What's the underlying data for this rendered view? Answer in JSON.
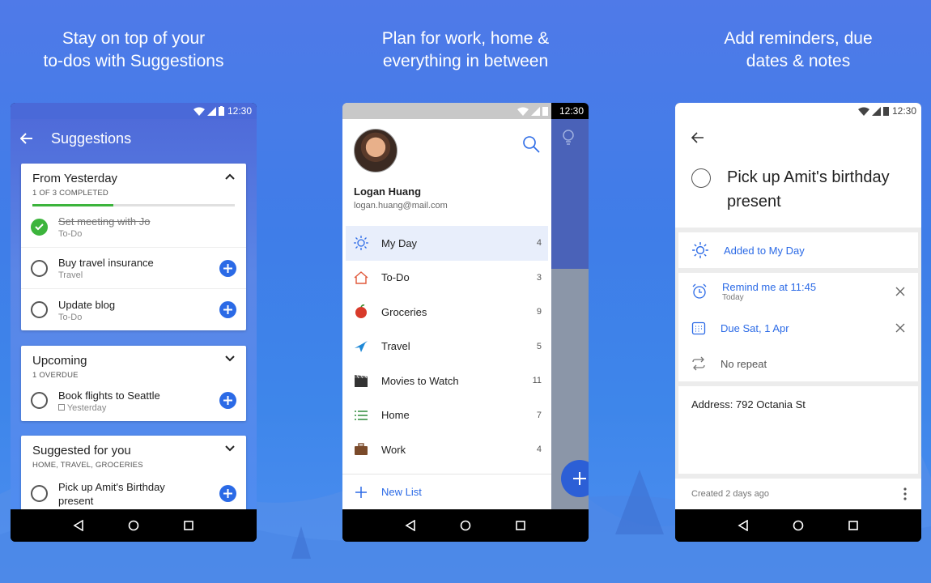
{
  "captions": [
    {
      "line1": "Stay on top of your",
      "line2": "to-dos with Suggestions"
    },
    {
      "line1": "Plan for work, home &",
      "line2": "everything in between"
    },
    {
      "line1": "Add reminders, due",
      "line2": "dates & notes"
    }
  ],
  "status_time": "12:30",
  "phone1": {
    "header_title": "Suggestions",
    "cards": [
      {
        "title": "From Yesterday",
        "subtitle": "1 OF 3 COMPLETED",
        "progress": 0.33,
        "tasks": [
          {
            "name": "Set meeting with Jo",
            "list": "To-Do",
            "completed": true
          },
          {
            "name": "Buy travel insurance",
            "list": "Travel",
            "completed": false
          },
          {
            "name": "Update blog",
            "list": "To-Do",
            "completed": false
          }
        ]
      },
      {
        "title": "Upcoming",
        "subtitle": "1 OVERDUE",
        "tasks": [
          {
            "name": "Book flights to Seattle",
            "list": "Yesterday",
            "completed": false
          }
        ]
      },
      {
        "title": "Suggested for you",
        "subtitle": "HOME, TRAVEL, GROCERIES",
        "tasks": [
          {
            "name": "Pick up Amit's Birthday present",
            "list": "",
            "completed": false
          }
        ]
      }
    ]
  },
  "phone2": {
    "user_name": "Logan Huang",
    "user_email": "logan.huang@mail.com",
    "lists": [
      {
        "label": "My Day",
        "count": "4",
        "icon": "sun-icon",
        "selected": true
      },
      {
        "label": "To-Do",
        "count": "3",
        "icon": "home-icon"
      },
      {
        "label": "Groceries",
        "count": "9",
        "icon": "apple-icon"
      },
      {
        "label": "Travel",
        "count": "5",
        "icon": "airplane-icon"
      },
      {
        "label": "Movies to Watch",
        "count": "11",
        "icon": "clapperboard-icon"
      },
      {
        "label": "Home",
        "count": "7",
        "icon": "list-icon"
      },
      {
        "label": "Work",
        "count": "4",
        "icon": "briefcase-icon"
      }
    ],
    "new_list_label": "New List"
  },
  "phone3": {
    "task_title_line1": "Pick up Amit's birthday",
    "task_title_line2": "present",
    "my_day_label": "Added to My Day",
    "reminder_label": "Remind me at 11:45",
    "reminder_sub": "Today",
    "due_label": "Due Sat, 1 Apr",
    "repeat_label": "No repeat",
    "note": "Address: 792 Octania St",
    "created": "Created 2 days ago"
  },
  "colors": {
    "accent": "#2b6ae6",
    "complete": "#3cb43c",
    "header_bg": "#4a69d8"
  }
}
